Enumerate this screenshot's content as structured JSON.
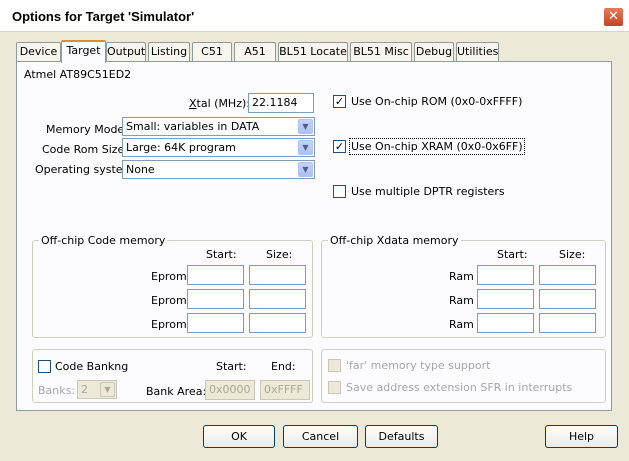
{
  "window": {
    "title": "Options for Target 'Simulator'",
    "close_glyph": "✕"
  },
  "tabs": [
    {
      "label": "Device"
    },
    {
      "label": "Target",
      "active": true
    },
    {
      "label": "Output"
    },
    {
      "label": "Listing"
    },
    {
      "label": "C51"
    },
    {
      "label": "A51"
    },
    {
      "label": "BL51 Locate"
    },
    {
      "label": "BL51 Misc"
    },
    {
      "label": "Debug"
    },
    {
      "label": "Utilities"
    }
  ],
  "target": {
    "device_name": "Atmel AT89C51ED2",
    "xtal_label_prefix": "",
    "xtal_label_u": "X",
    "xtal_label_rest": "tal (MHz):",
    "xtal_value": "22.1184",
    "memory_model_label": "Memory Model:",
    "memory_model_value": "Small: variables in DATA",
    "code_rom_label": "Code Rom Size:",
    "code_rom_value": "Large: 64K program",
    "os_label": "Operating system:",
    "os_value": "None",
    "onchip_rom": {
      "label": "Use On-chip ROM (0x0-0xFFFF)",
      "checked": true,
      "mark": "✓"
    },
    "onchip_xram": {
      "label": "Use On-chip XRAM (0x0-0x6FF)",
      "checked": true,
      "mark": "✓"
    },
    "multi_dptr": {
      "label": "Use multiple DPTR registers",
      "checked": false,
      "mark": ""
    }
  },
  "code_memory": {
    "title": "Off-chip Code memory",
    "start_header": "Start:",
    "size_header": "Size:",
    "rows": [
      {
        "label": "Eprom",
        "start": "",
        "size": ""
      },
      {
        "label": "Eprom",
        "start": "",
        "size": ""
      },
      {
        "label": "Eprom",
        "start": "",
        "size": ""
      }
    ]
  },
  "xdata_memory": {
    "title": "Off-chip Xdata memory",
    "start_header": "Start:",
    "size_header": "Size:",
    "rows": [
      {
        "label": "Ram",
        "start": "",
        "size": ""
      },
      {
        "label": "Ram",
        "start": "",
        "size": ""
      },
      {
        "label": "Ram",
        "start": "",
        "size": ""
      }
    ]
  },
  "banking": {
    "code_banking_label": "Code Bankng",
    "banks_label": "Banks:",
    "banks_value": "2",
    "start_header": "Start:",
    "end_header": "End:",
    "bank_area_label": "Bank Area:",
    "bank_area_start": "0x0000",
    "bank_area_end": "0xFFFF",
    "far_memory_label": "'far' memory type support",
    "save_address_label": "Save address extension SFR in interrupts"
  },
  "buttons": {
    "ok": "OK",
    "cancel": "Cancel",
    "defaults": "Defaults",
    "help": "Help"
  },
  "colors": {
    "dialog_bg": "#ece9d8",
    "panel_bg": "#fcfcfe",
    "close_button": "#c4441f",
    "tab_accent": "#e68b2c"
  }
}
